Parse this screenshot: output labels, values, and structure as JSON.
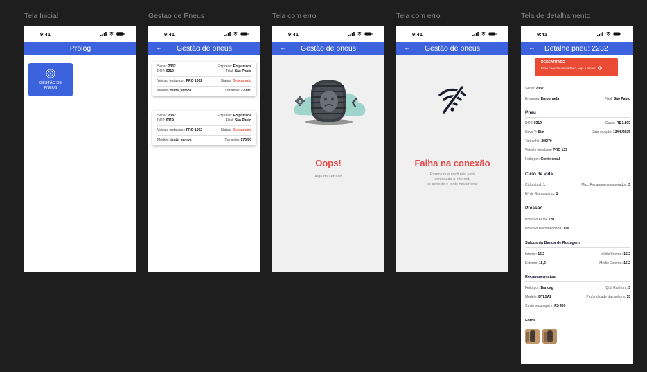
{
  "frame_labels": [
    "Tela Inicial",
    "Gestao de Pneus",
    "Tela com erro",
    "Tela com erro",
    "Tela de detalhamento"
  ],
  "status_time": "9:41",
  "colors": {
    "primary": "#3c63dd",
    "danger": "#e94b35",
    "background": "#1e1e1e"
  },
  "home": {
    "title": "Prolog",
    "tile": {
      "icon": "tire-icon",
      "label": "GESTÃO DE\nPNEUS"
    }
  },
  "list": {
    "title": "Gestão de pneus",
    "cards": [
      {
        "serial_label": "Serial:",
        "serial": "2332",
        "empresa_label": "Empresa:",
        "empresa": "Empurrada",
        "dot_label": "DOT:",
        "dot": "0319",
        "filial_label": "Filial:",
        "filial": "São Paulo",
        "veiculo_label": "Veiculo instalado :",
        "veiculo": "PRO 1002",
        "status_label": "Status:",
        "status": "Descartado",
        "modelo_label": "Modelo:",
        "modelo": "teste_vamos",
        "tamanho_label": "Tamanho:",
        "tamanho": "270/80"
      },
      {
        "serial_label": "Serial:",
        "serial": "2332",
        "empresa_label": "Empresa:",
        "empresa": "Empurrada",
        "dot_label": "DOT:",
        "dot": "0319",
        "filial_label": "Filial:",
        "filial": "São Paulo",
        "veiculo_label": "Veiculo instalado :",
        "veiculo": "PRO 1002",
        "status_label": "Status:",
        "status": "Descartado",
        "modelo_label": "Modelo:",
        "modelo": "teste_vamos",
        "tamanho_label": "Tamanho:",
        "tamanho": "270/80"
      }
    ]
  },
  "error1": {
    "title": "Gestão de pneus",
    "heading": "Oops!",
    "message": "Algo deu errado"
  },
  "error2": {
    "title": "Gestão de pneus",
    "heading": "Falha na conexão",
    "message_lines": [
      "Parece que você não está",
      "conectado a internet,",
      "se conecte e tente novamente"
    ]
  },
  "detail": {
    "title": "Detalhe pneu: 2232",
    "banner": {
      "title": "DESCARTADO",
      "subtitle": "Esse pneu foi descartado, veja o motivo"
    },
    "serial_label": "Serial:",
    "serial": "2332",
    "empresa_label": "Empresa:",
    "empresa": "Empurrada",
    "filial_label": "Filial:",
    "filial": "São Paulo",
    "pneu": {
      "heading": "Pneu",
      "dot_label": "DOT:",
      "dot": "0319",
      "custo_label": "Custo:",
      "custo": "R$ 1.500",
      "novo_label": "Novo ?:",
      "novo": "Sim",
      "data_label": "Data criação:",
      "data": "13/05/2025",
      "tamanho_label": "Tamanho:",
      "tamanho": "200/70",
      "veiculo_label": "Veiculo instalado:",
      "veiculo": "PRO 123",
      "feito_label": "Feito por:",
      "feito": "Continental"
    },
    "ciclo": {
      "heading": "Ciclo de vida",
      "atual_label": "Ciclo atual:",
      "atual": "1",
      "max_label": "Max. Recapagens esperados:",
      "max": "5",
      "recap_label": "Nº de Recapagens:",
      "recap": "1"
    },
    "pressao": {
      "heading": "Pressão",
      "atual_label": "Pressão Atual:",
      "atual": "120",
      "rec_label": "Pressão Recomendada:",
      "rec": "120"
    },
    "sulcos": {
      "heading": "Sulcos da Banda de Rodagem",
      "interno_label": "Interno:",
      "interno": "15,2",
      "medio_interno_label": "Médio Interno:",
      "medio_interno": "15,2",
      "externo_label": "Externo:",
      "externo": "15,2",
      "medio_externo_label": "Médio Externo:",
      "medio_externo": "15,2"
    },
    "recapagem": {
      "heading": "Recapagem atual",
      "feito_label": "Feito por:",
      "feito": "Bandag",
      "qtd_label": "Qtd. Ranhura:",
      "qtd": "5",
      "modelo_label": "Modelo:",
      "modelo": "BTL5A2",
      "prof_label": "Profundidade da ranhura:",
      "prof": "15",
      "custo_label": "Custo recapagem:",
      "custo": "R$ 400"
    },
    "fotos": {
      "heading": "Fotos"
    }
  }
}
